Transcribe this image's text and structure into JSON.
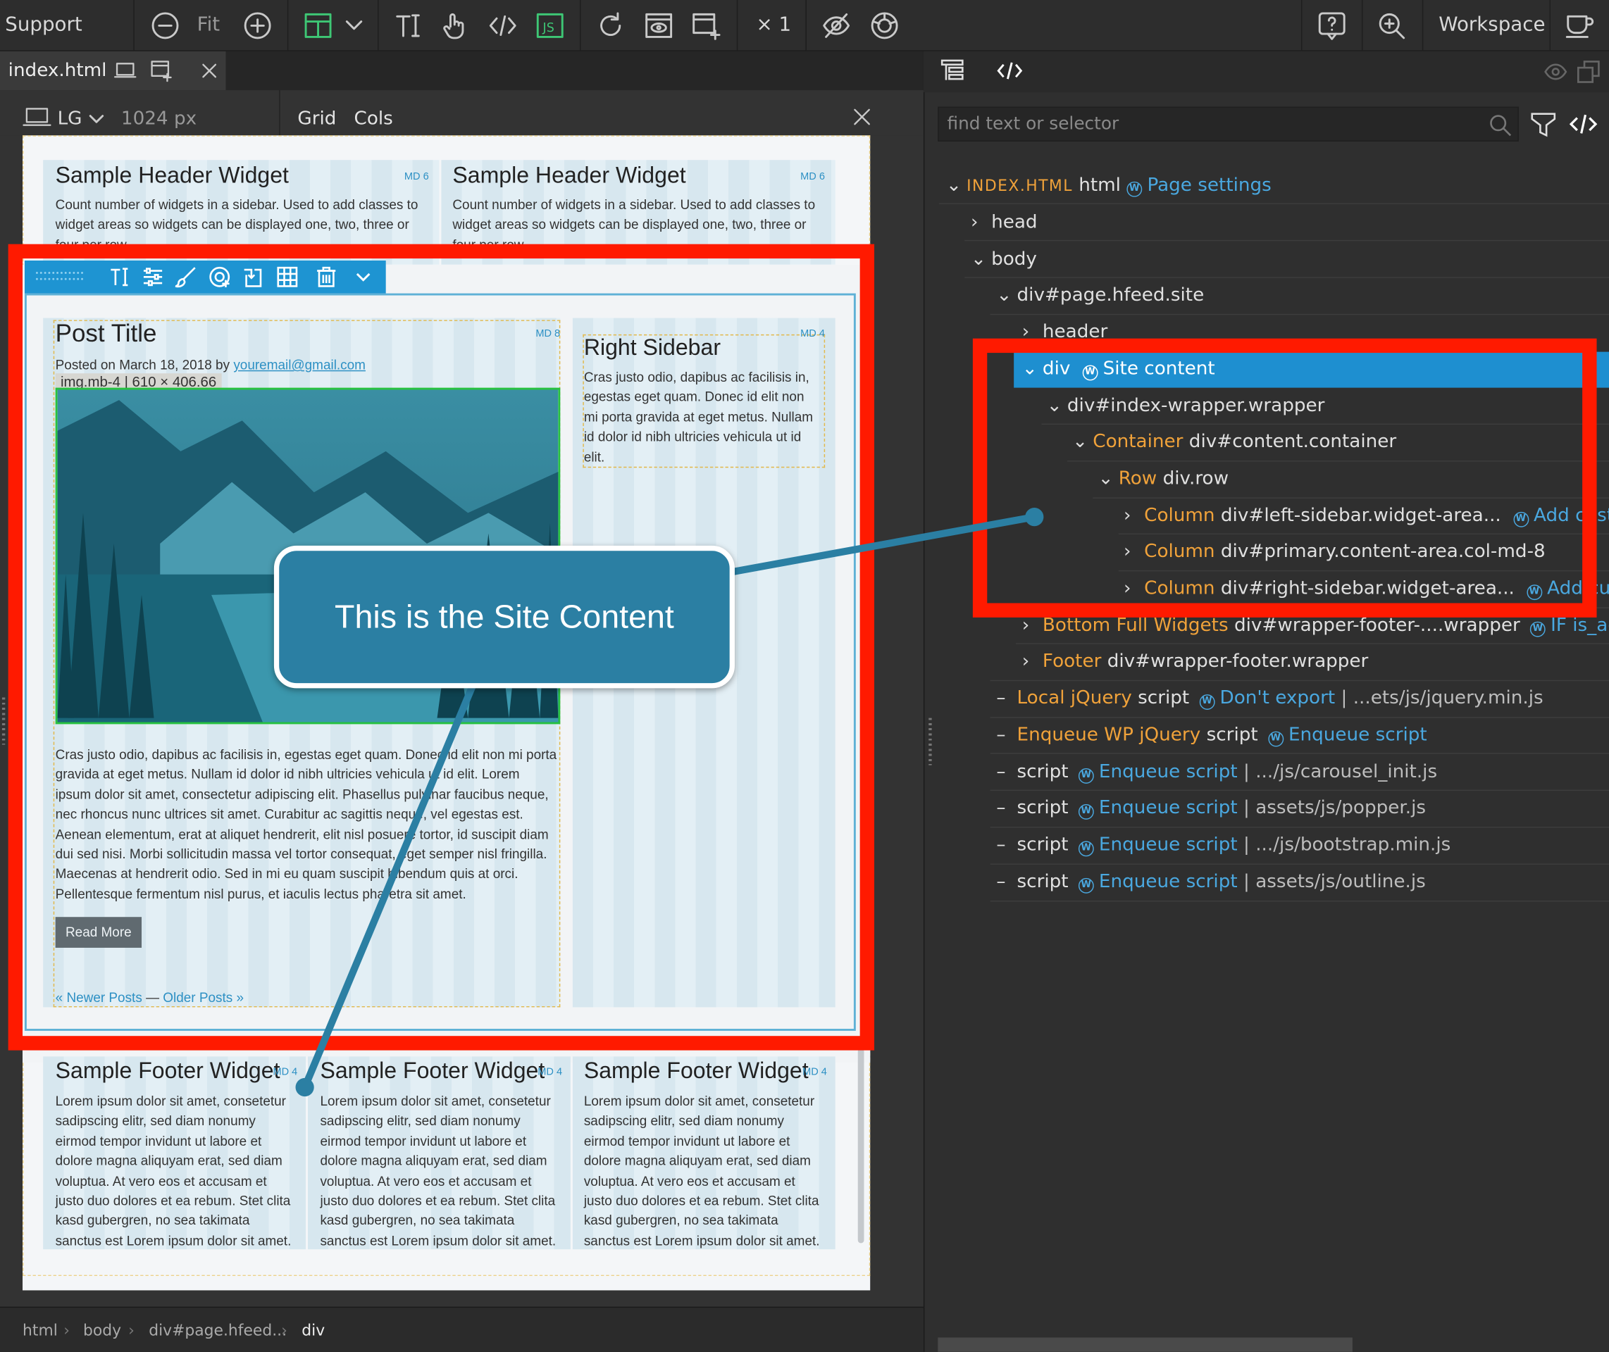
{
  "toolbar": {
    "support_label": "Support",
    "fit_label": "Fit",
    "multiplier_label": "× 1",
    "workspace_label": "Workspace"
  },
  "doc_tab": {
    "filename": "index.html"
  },
  "editor_bar": {
    "device": "LG",
    "width": "1024 px",
    "grid_label": "Grid",
    "cols_label": "Cols"
  },
  "page": {
    "header_widgets": [
      {
        "title": "Sample Header Widget",
        "badge": "MD 6",
        "text": "Count number of widgets in a sidebar. Used to add classes to widget areas so widgets can be displayed one, two, three or four per row."
      },
      {
        "title": "Sample Header Widget",
        "badge": "MD 6",
        "text": "Count number of widgets in a sidebar. Used to add classes to widget areas so widgets can be displayed one, two, three or four per row."
      }
    ],
    "post": {
      "title": "Post Title",
      "badge": "MD 8",
      "meta_prefix": "Posted on March 18, 2018 by",
      "meta_email": "youremail@gmail.com",
      "img_label": "img.mb-4 | 610 × 406.66",
      "body": "Cras justo odio, dapibus ac facilisis in, egestas eget quam. Donec id elit non mi porta gravida at eget metus. Nullam id dolor id nibh ultricies vehicula ut id elit. Lorem ipsum dolor sit amet, consectetur adipiscing elit. Phasellus pulvinar faucibus neque, nec rhoncus nunc ultrices sit amet. Curabitur ac sagittis neque, vel egestas est. Aenean elementum, erat at aliquet hendrerit, elit nisl posuere tortor, id suscipit diam dui sed nisi. Morbi sollicitudin massa vel tortor consequat, eget semper nisl fringilla. Maecenas at hendrerit odio. Sed in mi eu quam suscipit bibendum quis at orci. Pellentesque fermentum nisl purus, et iaculis lectus pharetra sit amet.",
      "read_more": "Read More",
      "nav_newer": "« Newer Posts",
      "nav_sep": "—",
      "nav_older": "Older Posts »"
    },
    "sidebar": {
      "title": "Right Sidebar",
      "badge": "MD 4",
      "text": "Cras justo odio, dapibus ac facilisis in, egestas eget quam. Donec id elit non mi porta gravida at eget metus. Nullam id dolor id nibh ultricies vehicula ut id elit."
    },
    "footer_widgets": [
      {
        "title": "Sample Footer Widget",
        "badge": "MD 4",
        "text": "Lorem ipsum dolor sit amet, consetetur sadipscing elitr, sed diam nonumy eirmod tempor invidunt ut labore et dolore magna aliquyam erat, sed diam voluptua. At vero eos et accusam et justo duo dolores et ea rebum. Stet clita kasd gubergren, no sea takimata sanctus est Lorem ipsum dolor sit amet."
      },
      {
        "title": "Sample Footer Widget",
        "badge": "MD 4",
        "text": "Lorem ipsum dolor sit amet, consetetur sadipscing elitr, sed diam nonumy eirmod tempor invidunt ut labore et dolore magna aliquyam erat, sed diam voluptua. At vero eos et accusam et justo duo dolores et ea rebum. Stet clita kasd gubergren, no sea takimata sanctus est Lorem ipsum dolor sit amet."
      },
      {
        "title": "Sample Footer Widget",
        "badge": "MD 4",
        "text": "Lorem ipsum dolor sit amet, consetetur sadipscing elitr, sed diam nonumy eirmod tempor invidunt ut labore et dolore magna aliquyam erat, sed diam voluptua. At vero eos et accusam et justo duo dolores et ea rebum. Stet clita kasd gubergren, no sea takimata sanctus est Lorem ipsum dolor sit amet."
      }
    ]
  },
  "callout": {
    "text": "This is the Site Content"
  },
  "breadcrumb": [
    "html",
    "body",
    "div#page.hfeed...",
    "div"
  ],
  "right_panel": {
    "search_placeholder": "find text or selector",
    "tree": {
      "root_label": "INDEX.HTML",
      "root_tag": "html",
      "root_link": "Page settings",
      "head": "head",
      "body": "body",
      "page_div": "div#page.hfeed.site",
      "header": "header",
      "site_tag": "div",
      "site_label": "Site content",
      "index_wrapper": "div#index-wrapper.wrapper",
      "container_label": "Container",
      "container_sel": "div#content.container",
      "row_label": "Row",
      "row_sel": "div.row",
      "columns": [
        {
          "label": "Column",
          "sel": "div#left-sidebar.widget-area...",
          "link": "Add custom"
        },
        {
          "label": "Column",
          "sel": "div#primary.content-area.col-md-8",
          "link": ""
        },
        {
          "label": "Column",
          "sel": "div#right-sidebar.widget-area...",
          "link": "Add custom"
        }
      ],
      "bottom_label": "Bottom Full Widgets",
      "bottom_sel": "div#wrapper-footer-....wrapper",
      "bottom_link": "IF is_active",
      "footer_label": "Footer",
      "footer_sel": "div#wrapper-footer.wrapper",
      "scripts": [
        {
          "label": "Local jQuery",
          "tag": "script",
          "link": "Don't export",
          "path": "...ets/js/jquery.min.js"
        },
        {
          "label": "Enqueue WP jQuery",
          "tag": "script",
          "link": "Enqueue script",
          "path": ""
        },
        {
          "label": "",
          "tag": "script",
          "link": "Enqueue script",
          "path": ".../js/carousel_init.js"
        },
        {
          "label": "",
          "tag": "script",
          "link": "Enqueue script",
          "path": "assets/js/popper.js"
        },
        {
          "label": "",
          "tag": "script",
          "link": "Enqueue script",
          "path": ".../js/bootstrap.min.js"
        },
        {
          "label": "",
          "tag": "script",
          "link": "Enqueue script",
          "path": "assets/js/outline.js"
        }
      ]
    }
  },
  "colors": {
    "highlight": "#ff1a00",
    "accent": "#2a8fcf",
    "callout": "#2b7fa3",
    "selected_row": "#1e8fd0"
  }
}
